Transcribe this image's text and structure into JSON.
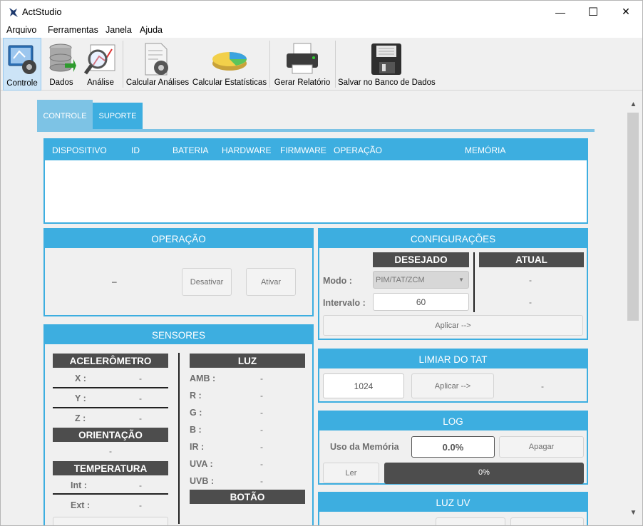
{
  "window": {
    "title": "ActStudio",
    "min": "—",
    "max": "☐",
    "close": "✕"
  },
  "menu": [
    "Arquivo",
    "Ferramentas",
    "Janela",
    "Ajuda"
  ],
  "toolbar": [
    "Controle",
    "Dados",
    "Análise",
    "Calcular Análises",
    "Calcular Estatísticas",
    "Gerar Relatório",
    "Salvar no Banco de Dados"
  ],
  "tabs": [
    "CONTROLE",
    "SUPORTE"
  ],
  "devices": {
    "columns": [
      "DISPOSITIVO",
      "ID",
      "BATERIA",
      "HARDWARE",
      "FIRMWARE",
      "OPERAÇÃO",
      "MEMÓRIA"
    ]
  },
  "operacao": {
    "title": "OPERAÇÃO",
    "status": "–",
    "desativar": "Desativar",
    "ativar": "Ativar"
  },
  "config": {
    "title": "CONFIGURAÇÕES",
    "desejado": "DESEJADO",
    "atual": "ATUAL",
    "modo_label": "Modo :",
    "modo_value": "PIM/TAT/ZCM",
    "modo_atual": "-",
    "intervalo_label": "Intervalo :",
    "intervalo_value": "60",
    "intervalo_atual": "-",
    "aplicar": "Aplicar -->"
  },
  "limiar": {
    "title": "LIMIAR DO TAT",
    "value": "1024",
    "aplicar": "Aplicar -->",
    "atual": "-"
  },
  "log": {
    "title": "LOG",
    "uso_label": "Uso da Memória",
    "uso_value": "0.0%",
    "apagar": "Apagar",
    "ler": "Ler",
    "progress": "0%",
    "progress_fraction": 0.0
  },
  "luz_uv": {
    "title": "LUZ UV"
  },
  "sensores": {
    "title": "SENSORES",
    "acel": "ACELERÔMETRO",
    "x": "X :",
    "y": "Y :",
    "z": "Z :",
    "x_val": "-",
    "y_val": "-",
    "z_val": "-",
    "orient": "ORIENTAÇÃO",
    "orient_val": "-",
    "temp": "TEMPERATURA",
    "int": "Int :",
    "ext": "Ext :",
    "int_val": "-",
    "ext_val": "-",
    "luz": "LUZ",
    "luz_items": [
      {
        "k": "AMB :",
        "v": "-"
      },
      {
        "k": "R :",
        "v": "-"
      },
      {
        "k": "G :",
        "v": "-"
      },
      {
        "k": "B :",
        "v": "-"
      },
      {
        "k": "IR :",
        "v": "-"
      },
      {
        "k": "UVA :",
        "v": "-"
      },
      {
        "k": "UVB :",
        "v": "-"
      }
    ],
    "botao": "BOTÃO"
  }
}
